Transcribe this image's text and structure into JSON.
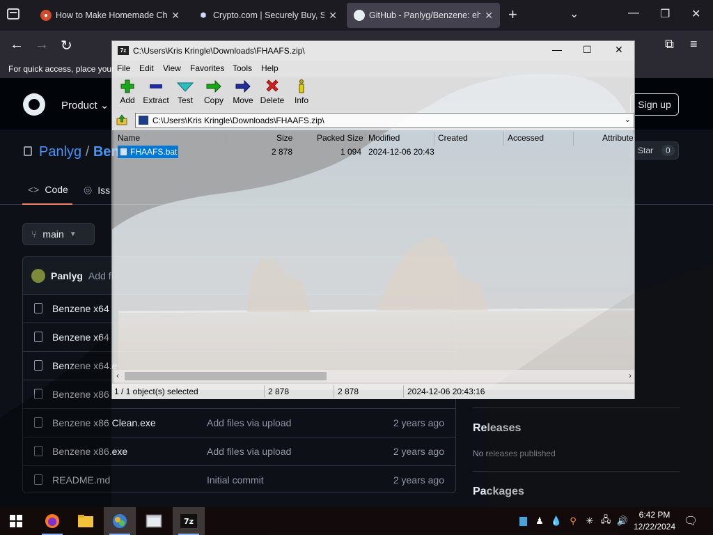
{
  "browser": {
    "tabs": [
      {
        "title": "How to Make Homemade Che",
        "favicon": "reddit-like-icon"
      },
      {
        "title": "Crypto.com | Securely Buy, Sell",
        "favicon": "crypto-icon"
      },
      {
        "title": "GitHub - Panlyg/Benzene: eh",
        "favicon": "github-icon"
      }
    ],
    "bookmarks_text": "For quick access, place your"
  },
  "github": {
    "product": "Product",
    "signup": "Sign up",
    "owner": "Panlyg",
    "repo_sep": " / ",
    "repo_partial": "Ben",
    "star_label": "Star",
    "star_count": "0",
    "tab_code": "Code",
    "tab_issues": "Iss",
    "branch": "main",
    "commit_author": "Panlyg",
    "commit_msg": "Add fi",
    "files": [
      {
        "name": "Benzene x64",
        "msg": "",
        "age": ""
      },
      {
        "name": "Benzene x64",
        "msg": "",
        "age": ""
      },
      {
        "name": "Benzene x64.e",
        "msg": "",
        "age": ""
      },
      {
        "name": "Benzene x86",
        "msg": "",
        "age": ""
      },
      {
        "name": "Benzene x86 Clean.exe",
        "msg": "Add files via upload",
        "age": "2 years ago"
      },
      {
        "name": "Benzene x86.exe",
        "msg": "Add files via upload",
        "age": "2 years ago"
      },
      {
        "name": "README.md",
        "msg": "Initial commit",
        "age": "2 years ago"
      }
    ],
    "releases_title": "Releases",
    "releases_text": "No releases published",
    "packages_title": "Packages"
  },
  "zip": {
    "title": "C:\\Users\\Kris Kringle\\Downloads\\FHAAFS.zip\\",
    "menu": [
      "File",
      "Edit",
      "View",
      "Favorites",
      "Tools",
      "Help"
    ],
    "toolbar": [
      {
        "label": "Add",
        "icon": "plus-icon",
        "color": "#1aa81a"
      },
      {
        "label": "Extract",
        "icon": "minus-icon",
        "color": "#1f2e9e"
      },
      {
        "label": "Test",
        "icon": "check-icon",
        "color": "#1aa8a8"
      },
      {
        "label": "Copy",
        "icon": "copy-arrow-icon",
        "color": "#1aa81a"
      },
      {
        "label": "Move",
        "icon": "move-arrow-icon",
        "color": "#1f2e9e"
      },
      {
        "label": "Delete",
        "icon": "delete-x-icon",
        "color": "#d01f1f"
      },
      {
        "label": "Info",
        "icon": "info-icon",
        "color": "#b8a800"
      }
    ],
    "path": "C:\\Users\\Kris Kringle\\Downloads\\FHAAFS.zip\\",
    "columns": [
      "Name",
      "Size",
      "Packed Size",
      "Modified",
      "Created",
      "Accessed",
      "Attribute"
    ],
    "files": [
      {
        "name": "FHAAFS.bat",
        "size": "2 878",
        "packed": "1 094",
        "modified": "2024-12-06 20:43"
      }
    ],
    "status": {
      "selected": "1 / 1 object(s) selected",
      "size": "2 878",
      "packed": "2 878",
      "modified": "2024-12-06 20:43:16"
    }
  },
  "taskbar": {
    "time": "6:42 PM",
    "date": "12/22/2024"
  }
}
